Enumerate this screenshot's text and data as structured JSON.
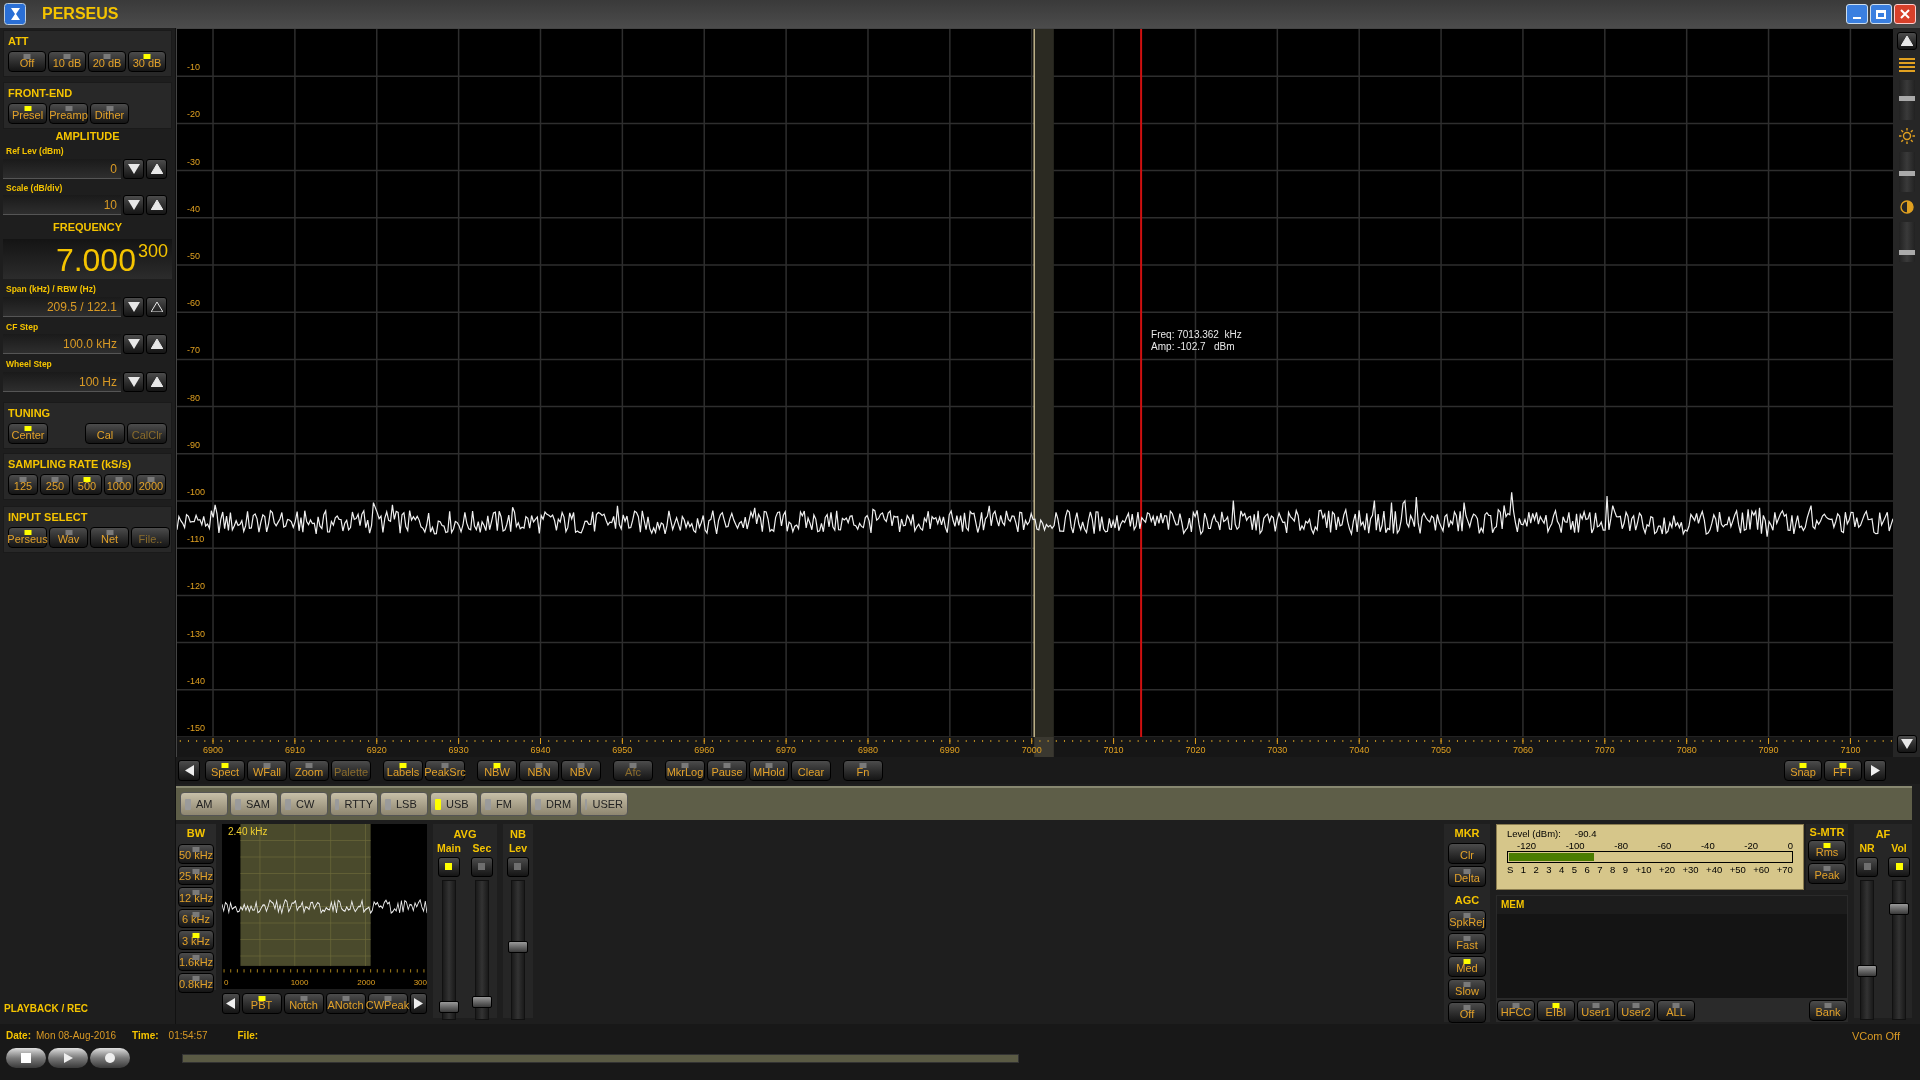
{
  "window": {
    "title": "PERSEUS"
  },
  "sidebar": {
    "att": {
      "title": "ATT",
      "buttons": [
        {
          "label": "Off",
          "kind": "led",
          "on": false,
          "disabled": false
        },
        {
          "label": "10 dB",
          "kind": "led",
          "on": false,
          "disabled": false
        },
        {
          "label": "20 dB",
          "kind": "led",
          "on": false,
          "disabled": false
        },
        {
          "label": "30 dB",
          "kind": "led",
          "on": true,
          "disabled": false
        }
      ]
    },
    "front_end": {
      "title": "FRONT-END",
      "buttons": [
        {
          "label": "Presel",
          "kind": "led",
          "on": true,
          "disabled": false
        },
        {
          "label": "Preamp",
          "kind": "led",
          "on": false,
          "disabled": false
        },
        {
          "label": "Dither",
          "kind": "led",
          "on": false,
          "disabled": false
        }
      ]
    },
    "amplitude": {
      "title": "AMPLITUDE",
      "fields": [
        {
          "label": "Ref Lev (dBm)",
          "value": "0",
          "up_disabled": false
        },
        {
          "label": "Scale (dB/div)",
          "value": "10",
          "up_disabled": false
        }
      ]
    },
    "frequency": {
      "title": "FREQUENCY",
      "main": "7.000",
      "fine": "300",
      "fields": [
        {
          "label": "Span (kHz) / RBW (Hz)",
          "value": "209.5 / 122.1",
          "up_disabled": true
        },
        {
          "label": "CF Step",
          "value": "100.0 kHz",
          "up_disabled": false
        },
        {
          "label": "Wheel Step",
          "value": "100 Hz",
          "up_disabled": false
        }
      ]
    },
    "tuning": {
      "title": "TUNING",
      "buttons": [
        {
          "label": "Center",
          "kind": "led",
          "on": true,
          "disabled": false
        },
        {
          "label": "Cal",
          "kind": "plain",
          "disabled": false
        },
        {
          "label": "CalClr",
          "kind": "plain",
          "disabled": true
        }
      ]
    },
    "sampling": {
      "title": "SAMPLING RATE (kS/s)",
      "buttons": [
        {
          "label": "125",
          "kind": "led",
          "on": false,
          "disabled": false
        },
        {
          "label": "250",
          "kind": "led",
          "on": false,
          "disabled": false
        },
        {
          "label": "500",
          "kind": "led",
          "on": true,
          "disabled": false
        },
        {
          "label": "1000",
          "kind": "led",
          "on": false,
          "disabled": false
        },
        {
          "label": "2000",
          "kind": "led",
          "on": false,
          "disabled": false
        }
      ]
    },
    "input_select": {
      "title": "INPUT SELECT",
      "buttons": [
        {
          "label": "Perseus",
          "kind": "led",
          "on": true,
          "disabled": false
        },
        {
          "label": "Wav",
          "kind": "led",
          "on": false,
          "disabled": false
        },
        {
          "label": "Net",
          "kind": "led",
          "on": false,
          "disabled": false
        },
        {
          "label": "File..",
          "kind": "plain",
          "disabled": true
        }
      ]
    },
    "playback_title": "PLAYBACK / REC"
  },
  "spectrum": {
    "y_labels": [
      "-10",
      "-20",
      "-30",
      "-40",
      "-50",
      "-60",
      "-70",
      "-80",
      "-90",
      "-100",
      "-110",
      "-120",
      "-130",
      "-140",
      "-150"
    ],
    "x_labels": [
      "6900",
      "6910",
      "6920",
      "6930",
      "6940",
      "6950",
      "6960",
      "6970",
      "6980",
      "6990",
      "7000",
      "7010",
      "7020",
      "7030",
      "7040",
      "7050",
      "7060",
      "7070",
      "7080",
      "7090",
      "7100"
    ],
    "marker": {
      "freq": "Freq: 7013.362  kHz",
      "amp": "Amp: -102.7   dBm"
    },
    "side_sliders": [
      {
        "level": 0.55
      },
      {
        "level": 0.45
      },
      {
        "level": 0.2
      }
    ]
  },
  "toolbar": {
    "groups": [
      {
        "buttons": [
          {
            "label": "Spect",
            "kind": "led",
            "on": true,
            "disabled": false
          },
          {
            "label": "WFall",
            "kind": "led",
            "on": false,
            "disabled": false
          },
          {
            "label": "Zoom",
            "kind": "led",
            "on": false,
            "disabled": false
          },
          {
            "label": "Palette",
            "kind": "plain",
            "disabled": true
          }
        ]
      },
      {
        "buttons": [
          {
            "label": "Labels",
            "kind": "led",
            "on": true,
            "disabled": false
          },
          {
            "label": "PeakSrc",
            "kind": "led",
            "on": false,
            "disabled": false
          }
        ]
      },
      {
        "buttons": [
          {
            "label": "NBW",
            "kind": "led",
            "on": true,
            "disabled": false
          },
          {
            "label": "NBN",
            "kind": "led",
            "on": false,
            "disabled": false
          },
          {
            "label": "NBV",
            "kind": "led",
            "on": false,
            "disabled": false
          }
        ]
      },
      {
        "buttons": [
          {
            "label": "Afc",
            "kind": "led",
            "on": false,
            "disabled": true
          }
        ]
      },
      {
        "buttons": [
          {
            "label": "MkrLog",
            "kind": "led",
            "on": false,
            "disabled": false
          },
          {
            "label": "Pause",
            "kind": "led",
            "on": false,
            "disabled": false
          },
          {
            "label": "MHold",
            "kind": "led",
            "on": false,
            "disabled": false
          },
          {
            "label": "Clear",
            "kind": "plain",
            "disabled": false
          }
        ]
      },
      {
        "buttons": [
          {
            "label": "Fn",
            "kind": "led",
            "on": false,
            "disabled": false
          }
        ]
      }
    ],
    "right": [
      {
        "label": "Snap",
        "kind": "led",
        "on": true,
        "disabled": false
      },
      {
        "label": "FFT",
        "kind": "led",
        "on": true,
        "disabled": false
      }
    ]
  },
  "modes": [
    {
      "label": "AM",
      "selected": false
    },
    {
      "label": "SAM",
      "selected": false
    },
    {
      "label": "CW",
      "selected": false
    },
    {
      "label": "RTTY",
      "selected": false
    },
    {
      "label": "LSB",
      "selected": false
    },
    {
      "label": "USB",
      "selected": true
    },
    {
      "label": "FM",
      "selected": false
    },
    {
      "label": "DRM",
      "selected": false
    },
    {
      "label": "USER",
      "selected": false
    }
  ],
  "bw": {
    "title": "BW",
    "buttons": [
      {
        "label": "50 kHz",
        "kind": "led",
        "on": false,
        "disabled": false
      },
      {
        "label": "25 kHz",
        "kind": "led",
        "on": false,
        "disabled": false
      },
      {
        "label": "12 kHz",
        "kind": "led",
        "on": false,
        "disabled": false
      },
      {
        "label": "6 kHz",
        "kind": "led",
        "on": false,
        "disabled": false
      },
      {
        "label": "3 kHz",
        "kind": "led",
        "on": true,
        "disabled": false
      },
      {
        "label": "1.6kHz",
        "kind": "led",
        "on": false,
        "disabled": false
      },
      {
        "label": "0.8kHz",
        "kind": "led",
        "on": false,
        "disabled": false
      }
    ]
  },
  "filter": {
    "bandwidth": "2.40 kHz",
    "x_labels": [
      "0",
      "1000",
      "2000",
      "300"
    ],
    "buttons": [
      {
        "label": "PBT",
        "kind": "led",
        "on": true,
        "disabled": false
      },
      {
        "label": "Notch",
        "kind": "led",
        "on": false,
        "disabled": false
      },
      {
        "label": "ANotch",
        "kind": "led",
        "on": false,
        "disabled": false
      },
      {
        "label": "CWPeak",
        "kind": "led",
        "on": false,
        "disabled": false
      }
    ]
  },
  "avg": {
    "title": "AVG",
    "channels": [
      {
        "label": "Main",
        "on": true,
        "level": 0.04
      },
      {
        "label": "Sec",
        "on": false,
        "level": 0.08
      }
    ]
  },
  "nb": {
    "title": "NB",
    "channels": [
      {
        "label": "Lev",
        "on": false,
        "level": 0.52
      }
    ]
  },
  "mkr": {
    "title": "MKR",
    "buttons": [
      {
        "label": "Clr",
        "kind": "plain",
        "disabled": false
      },
      {
        "label": "Delta",
        "kind": "led",
        "on": false,
        "disabled": false
      }
    ]
  },
  "agc": {
    "title": "AGC",
    "buttons": [
      {
        "label": "SpkRej",
        "kind": "led",
        "on": false,
        "disabled": false
      },
      {
        "label": "Fast",
        "kind": "led",
        "on": false,
        "disabled": false
      },
      {
        "label": "Med",
        "kind": "led",
        "on": true,
        "disabled": false
      },
      {
        "label": "Slow",
        "kind": "led",
        "on": false,
        "disabled": false
      },
      {
        "label": "Off",
        "kind": "led",
        "on": false,
        "disabled": false
      }
    ]
  },
  "smeter": {
    "title": "S-MTR",
    "reading_label": "Level (dBm):",
    "reading": "-90.4",
    "dbm_scale": [
      "-120",
      "-100",
      "-80",
      "-60",
      "-40",
      "-20",
      "0"
    ],
    "s_scale": [
      "S",
      "1",
      "2",
      "3",
      "4",
      "5",
      "6",
      "7",
      "8",
      "9",
      "+10",
      "+20",
      "+30",
      "+40",
      "+50",
      "+60",
      "+70"
    ],
    "level": 0.3,
    "buttons": [
      {
        "label": "Rms",
        "kind": "led",
        "on": true,
        "disabled": false
      },
      {
        "label": "Peak",
        "kind": "led",
        "on": false,
        "disabled": false
      }
    ]
  },
  "mem": {
    "title": "MEM",
    "buttons": [
      {
        "label": "HFCC",
        "kind": "led",
        "on": false,
        "disabled": false
      },
      {
        "label": "EIBI",
        "kind": "led",
        "on": true,
        "disabled": false
      },
      {
        "label": "User1",
        "kind": "led",
        "on": false,
        "disabled": false
      },
      {
        "label": "User2",
        "kind": "led",
        "on": false,
        "disabled": false
      },
      {
        "label": "ALL",
        "kind": "led",
        "on": false,
        "disabled": false
      }
    ],
    "bank": {
      "label": "Bank",
      "kind": "led",
      "on": false,
      "disabled": false
    }
  },
  "af": {
    "title": "AF",
    "channels": [
      {
        "label": "NR",
        "on": false,
        "level": 0.33
      },
      {
        "label": "Vol",
        "on": true,
        "level": 0.82
      }
    ]
  },
  "status": {
    "date_label": "Date:",
    "date": "Mon 08-Aug-2016",
    "time_label": "Time:",
    "time": "01:54:57",
    "file_label": "File:",
    "vcom": "VCom Off"
  }
}
